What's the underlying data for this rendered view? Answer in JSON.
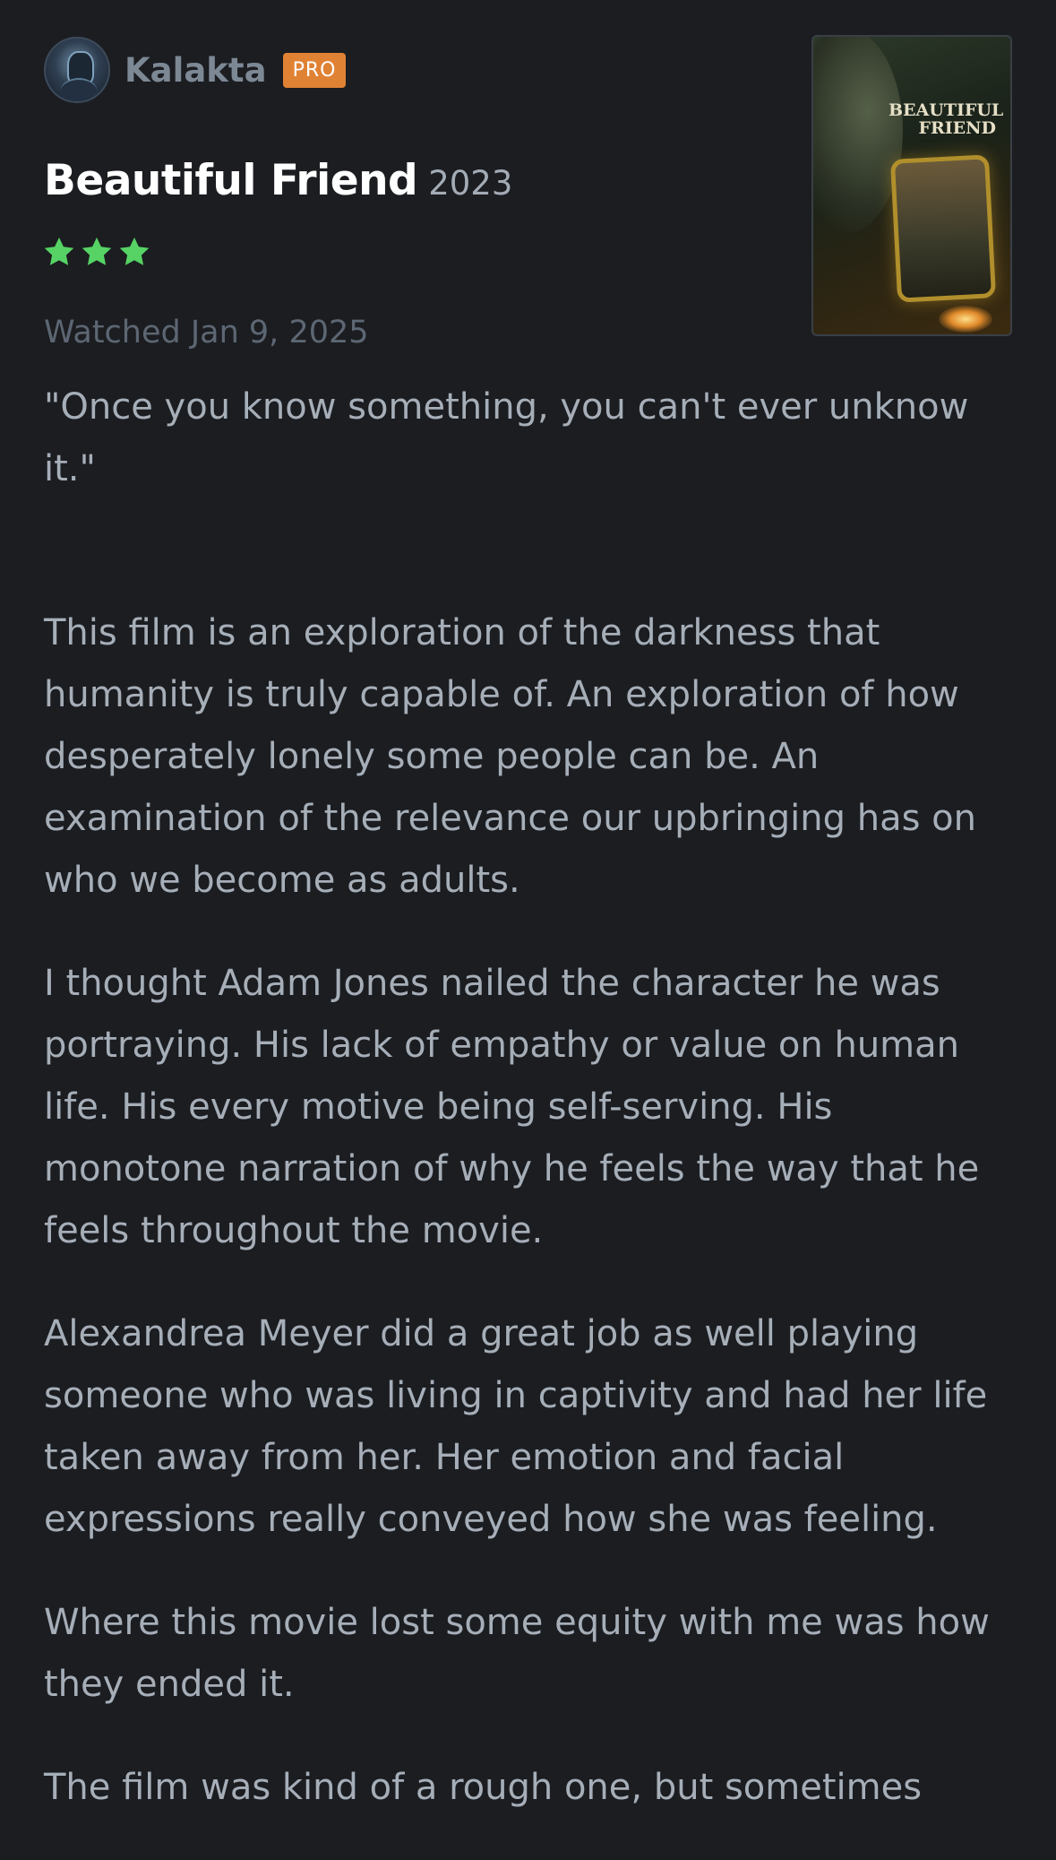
{
  "reviewer": {
    "name": "Kalakta",
    "badge": "PRO"
  },
  "film": {
    "title": "Beautiful Friend",
    "year": "2023",
    "poster_title": "BEAUTIFUL FRIEND"
  },
  "rating": {
    "stars": 3,
    "max_stars": 5,
    "star_color": "#56d364"
  },
  "watched": "Watched Jan 9, 2025",
  "review": {
    "quote": "\"Once you know something, you can't ever unknow it.\"",
    "paragraphs": [
      "This film is an exploration of the darkness that humanity is truly capable of. An exploration of how desperately lonely some people can be. An examination of the relevance our upbringing has on who we become as adults.",
      "I thought Adam Jones nailed the character he was portraying. His lack of empathy or value on human life. His every motive being self-serving. His monotone narration of why he feels the way that he feels throughout the movie.",
      "Alexandrea Meyer did a great job as well playing someone who was living in captivity and had her life taken away from her. Her emotion and facial expressions really conveyed how she was feeling.",
      "Where this movie lost some equity with me was how they ended it.",
      "The film was kind of a rough one, but sometimes"
    ]
  },
  "colors": {
    "background": "#1b1d21",
    "pro_badge": "#e08234",
    "title": "#ffffff",
    "body_text": "#a6aeb8"
  },
  "icons": {
    "avatar": "reviewer-avatar",
    "star": "star-icon"
  }
}
